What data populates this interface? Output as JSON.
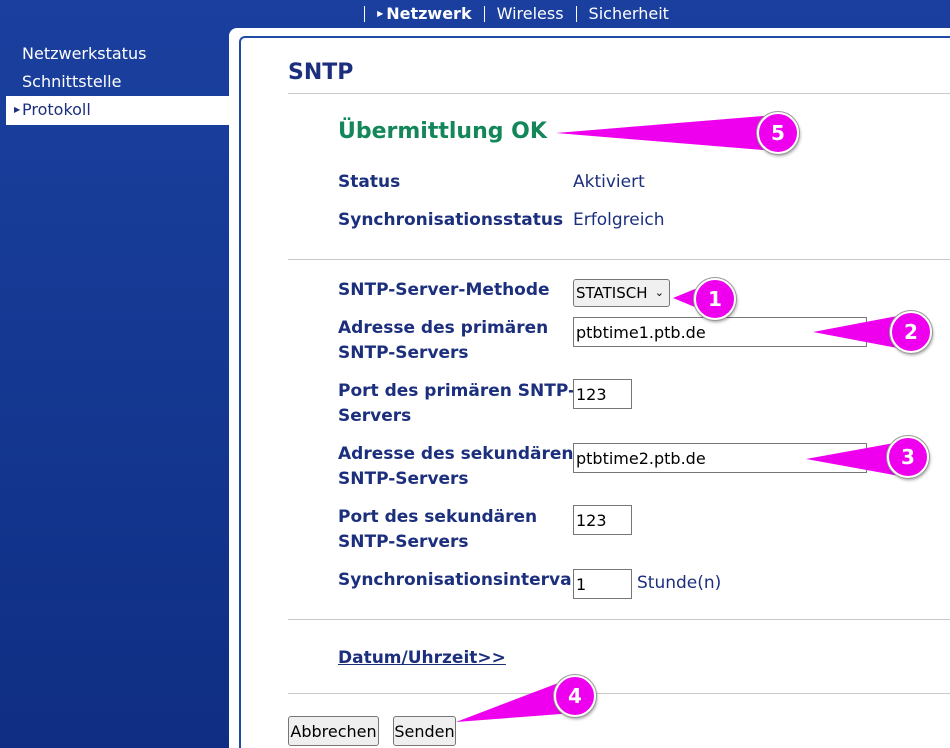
{
  "topnav": {
    "tabs": [
      {
        "label": "Netzwerk",
        "active": true
      },
      {
        "label": "Wireless",
        "active": false
      },
      {
        "label": "Sicherheit",
        "active": false
      }
    ]
  },
  "sidebar": {
    "items": [
      {
        "label": "Netzwerkstatus",
        "active": false
      },
      {
        "label": "Schnittstelle",
        "active": false
      },
      {
        "label": "Protokoll",
        "active": true
      }
    ]
  },
  "main": {
    "title": "SNTP",
    "ok_message": "Übermittlung OK",
    "status": {
      "label": "Status",
      "value": "Aktiviert"
    },
    "sync_status": {
      "label": "Synchronisationsstatus",
      "value": "Erfolgreich"
    },
    "method": {
      "label": "SNTP-Server-Methode",
      "value": "STATISCH"
    },
    "primary_address": {
      "label_line1": "Adresse des primären",
      "label_line2": "SNTP-Servers",
      "value": "ptbtime1.ptb.de"
    },
    "primary_port": {
      "label_line1": "Port des primären SNTP-",
      "label_line2": "Servers",
      "value": "123"
    },
    "secondary_address": {
      "label_line1": "Adresse des sekundären",
      "label_line2": "SNTP-Servers",
      "value": "ptbtime2.ptb.de"
    },
    "secondary_port": {
      "label_line1": "Port des sekundären",
      "label_line2": "SNTP-Servers",
      "value": "123"
    },
    "interval": {
      "label": "Synchronisationsintervall",
      "value": "1",
      "unit": "Stunde(n)"
    },
    "datetime_link": "Datum/Uhrzeit>>",
    "cancel_label": "Abbrechen",
    "send_label": "Senden"
  },
  "callouts": {
    "c1": "1",
    "c2": "2",
    "c3": "3",
    "c4": "4",
    "c5": "5",
    "color": "#ee00ee"
  }
}
